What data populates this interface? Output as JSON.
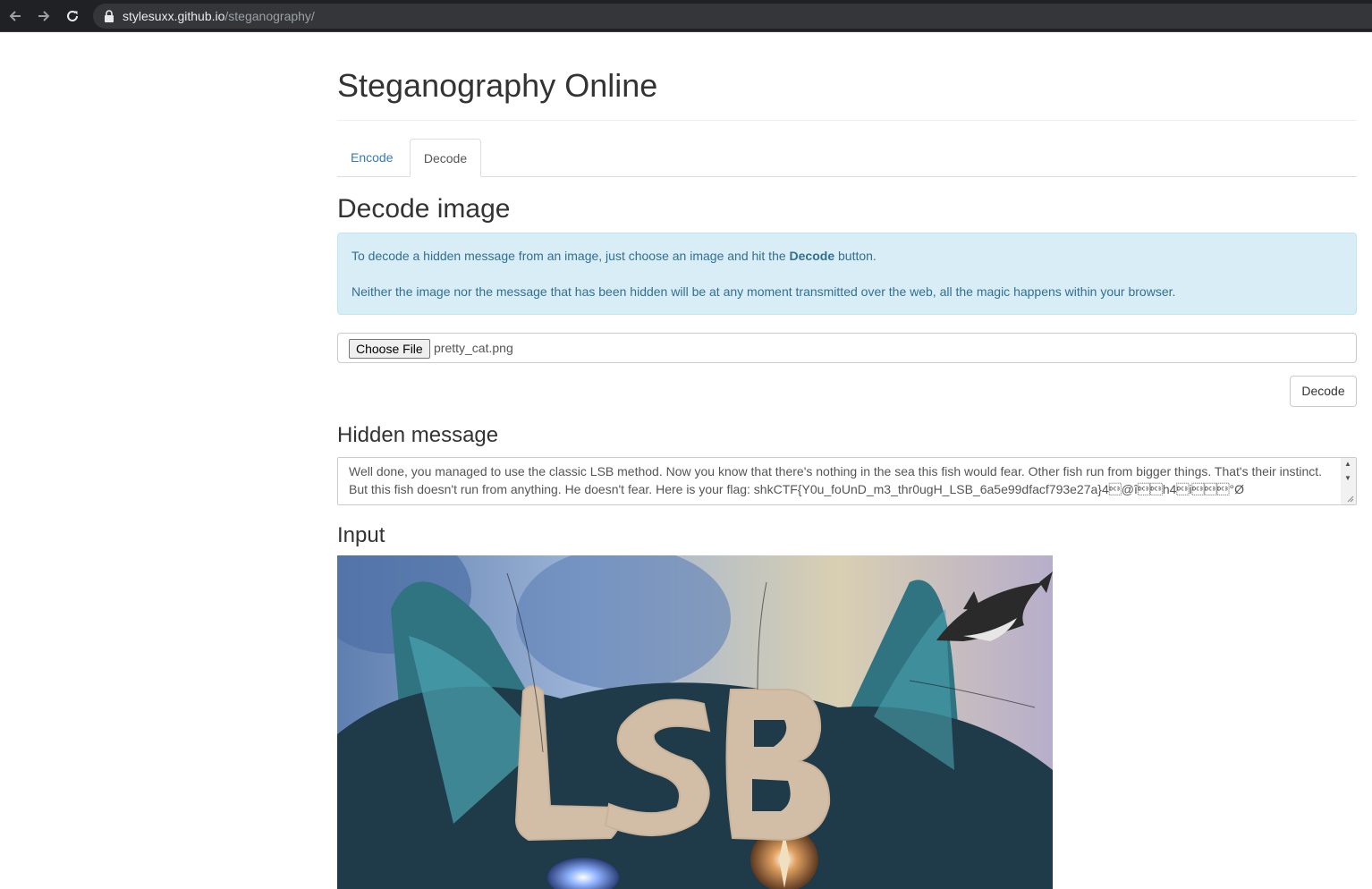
{
  "browser": {
    "url_host": "stylesuxx.github.io",
    "url_path": "/steganography/",
    "back_icon": "arrow-left-icon",
    "forward_icon": "arrow-right-icon",
    "reload_icon": "reload-icon",
    "lock_icon": "lock-icon"
  },
  "page": {
    "title": "Steganography Online"
  },
  "tabs": [
    {
      "label": "Encode",
      "active": false
    },
    {
      "label": "Decode",
      "active": true
    }
  ],
  "decode": {
    "heading": "Decode image",
    "info_line1_before": "To decode a hidden message from an image, just choose an image and hit the ",
    "info_line1_bold": "Decode",
    "info_line1_after": " button.",
    "info_line2": "Neither the image nor the message that has been hidden will be at any moment transmitted over the web, all the magic happens within your browser.",
    "choose_file_label": "Choose File",
    "file_name": "pretty_cat.png",
    "decode_button": "Decode"
  },
  "hidden_message": {
    "heading": "Hidden message",
    "text": "Well done, you managed to use the classic LSB method. Now you know that there's nothing in the sea this fish would fear. Other fish run from bigger things. That's their instinct. But this fish doesn't run from anything. He doesn't fear. Here is your flag: shkCTF{Y0u_foUnD_m3_thr0ugH_LSB_6a5e99dfacf793e27a}4\u0013@î\u0013\u0013h4\u0013i\u0013\u0013\u0013°Ø"
  },
  "input": {
    "heading": "Input",
    "image_text": "LSB",
    "colors": {
      "fur": "#2b4a58",
      "teal": "#3d8c99",
      "background": "#8fa3c4",
      "sand": "#d8c4a8",
      "lsb": "#d2bea6"
    }
  }
}
